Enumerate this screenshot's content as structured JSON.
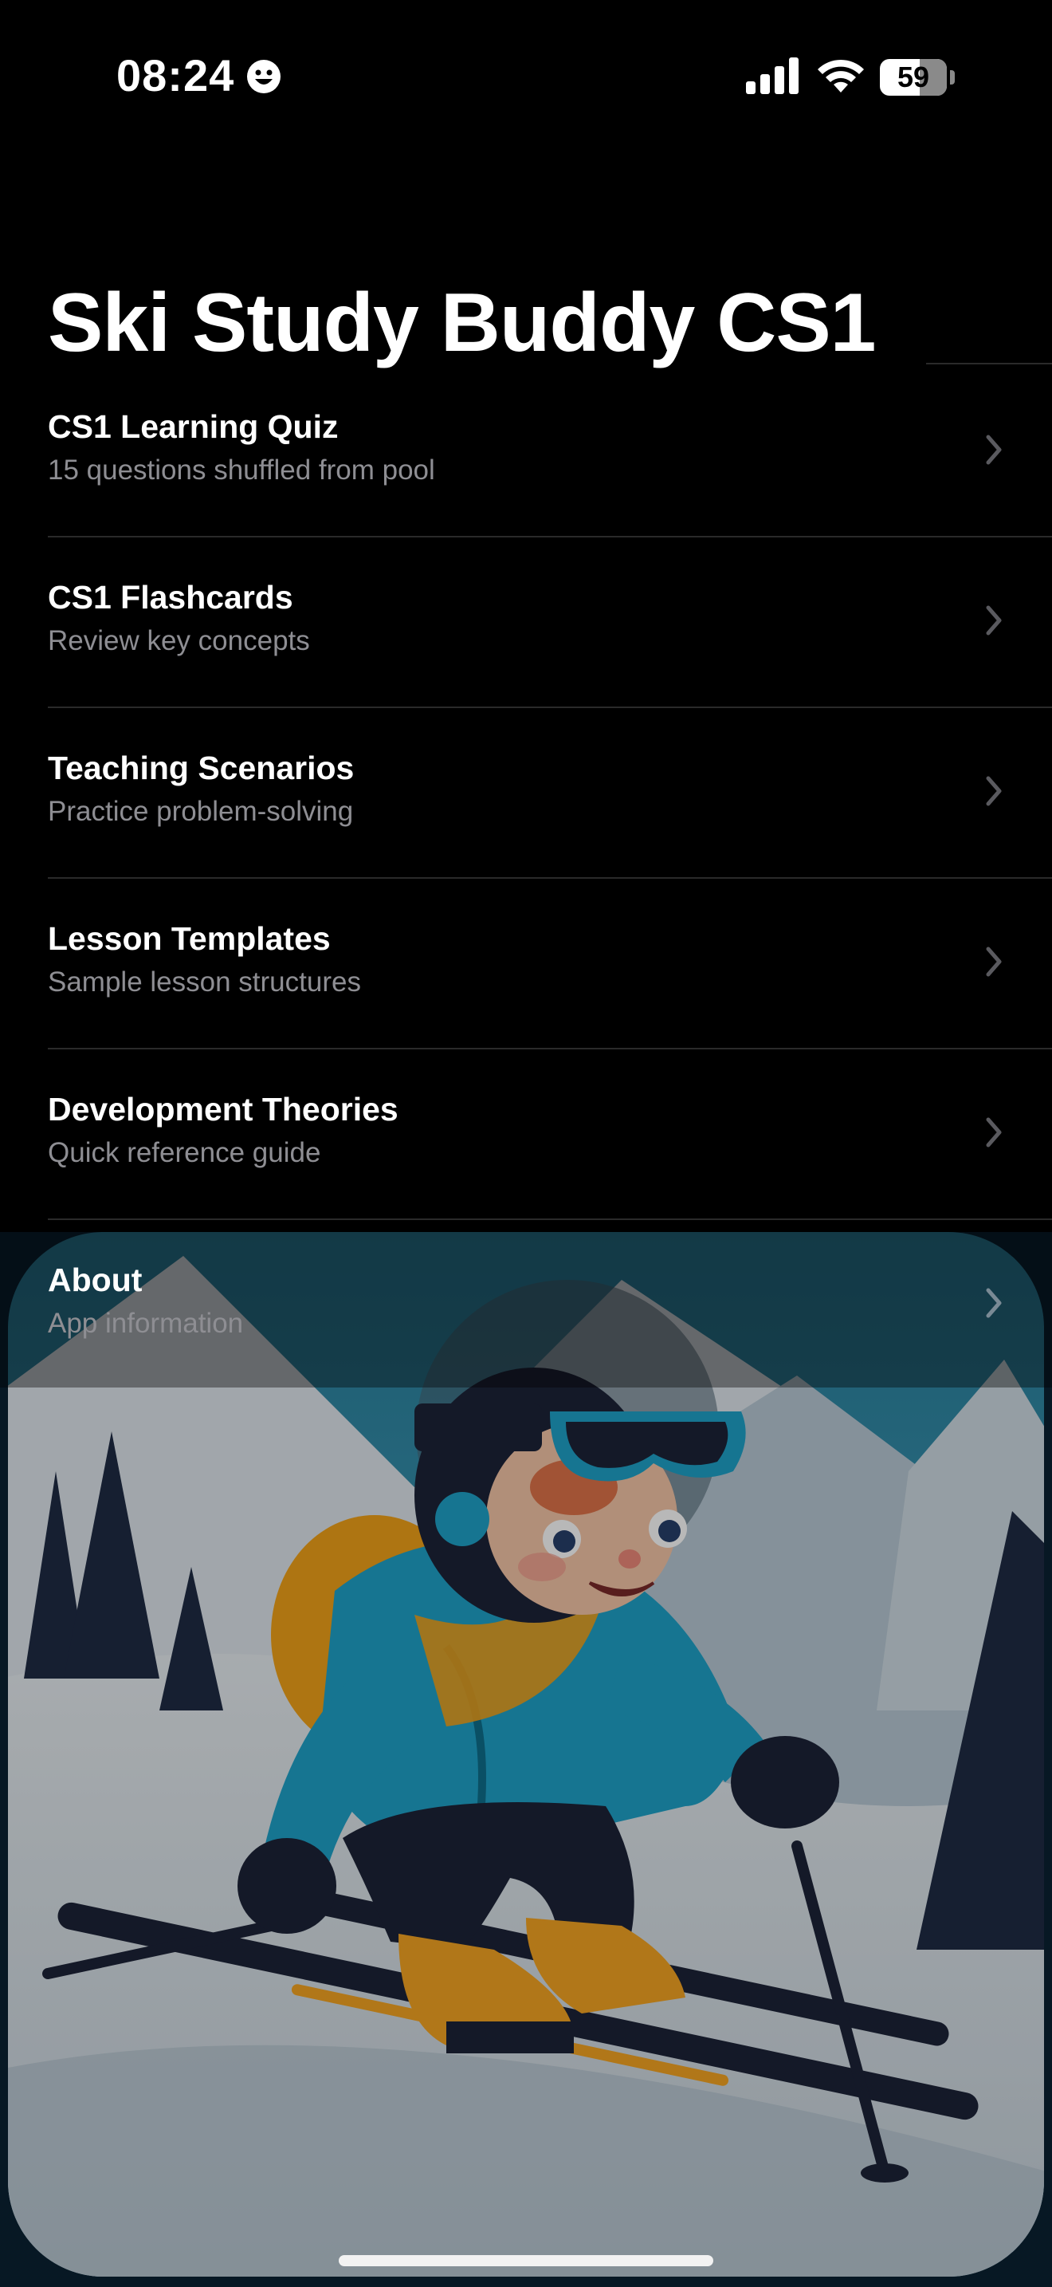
{
  "status_bar": {
    "time": "08:24",
    "battery": "59",
    "icons": [
      "smiley-icon",
      "cellular-signal-icon",
      "wifi-icon",
      "battery-icon"
    ]
  },
  "page": {
    "title": "Ski Study Buddy CS1"
  },
  "menu": {
    "items": [
      {
        "title": "CS1 Learning Quiz",
        "subtitle": "15 questions shuffled from pool"
      },
      {
        "title": "CS1 Flashcards",
        "subtitle": "Review key concepts"
      },
      {
        "title": "Teaching Scenarios",
        "subtitle": "Practice problem-solving"
      },
      {
        "title": "Lesson Templates",
        "subtitle": "Sample lesson structures"
      },
      {
        "title": "Development Theories",
        "subtitle": "Quick reference guide"
      },
      {
        "title": "About",
        "subtitle": "App information"
      }
    ]
  },
  "illustration": {
    "subject": "cartoon-child-skier",
    "colors": {
      "sky": "#2f8fb0",
      "snow": "#dfe6ec",
      "jacket": "#1fa3c9",
      "backpack": "#f2a21a",
      "pants": "#1d2338",
      "boots": "#f5a623",
      "trees": "#1f2b45"
    }
  },
  "colors": {
    "background": "#000000",
    "text_primary": "#ffffff",
    "text_secondary": "#8e8e93",
    "separator": "#2a2a2a",
    "chevron": "#5a5a5f"
  }
}
